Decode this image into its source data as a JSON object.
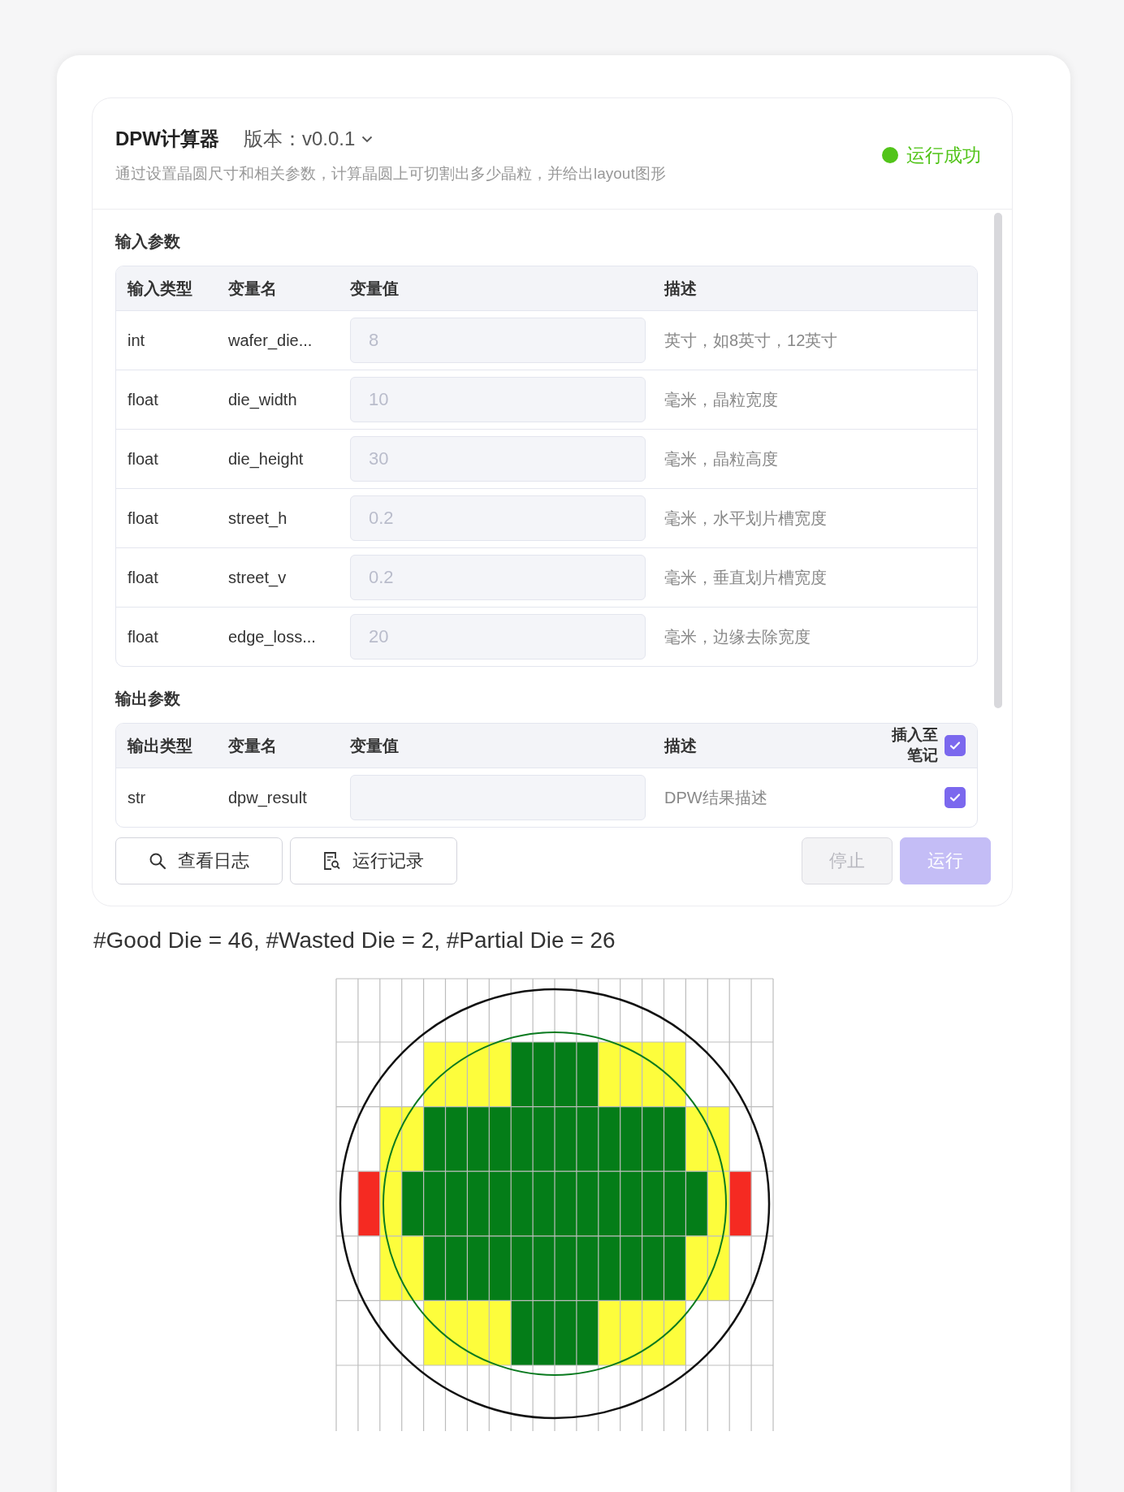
{
  "header": {
    "title": "DPW计算器",
    "version_label": "版本：v0.0.1",
    "description": "通过设置晶圆尺寸和相关参数，计算晶圆上可切割出多少晶粒，并给出layout图形",
    "status": {
      "kind": "success",
      "text": "运行成功"
    }
  },
  "input_section": {
    "title": "输入参数",
    "columns": [
      "输入类型",
      "变量名",
      "变量值",
      "描述"
    ],
    "rows": [
      {
        "type": "int",
        "name": "wafer_die...",
        "value": "8",
        "description": "英寸，如8英寸，12英寸"
      },
      {
        "type": "float",
        "name": "die_width",
        "value": "10",
        "description": "毫米，晶粒宽度"
      },
      {
        "type": "float",
        "name": "die_height",
        "value": "30",
        "description": "毫米，晶粒高度"
      },
      {
        "type": "float",
        "name": "street_h",
        "value": "0.2",
        "description": "毫米，水平划片槽宽度"
      },
      {
        "type": "float",
        "name": "street_v",
        "value": "0.2",
        "description": "毫米，垂直划片槽宽度"
      },
      {
        "type": "float",
        "name": "edge_loss...",
        "value": "20",
        "description": "毫米，边缘去除宽度"
      }
    ]
  },
  "output_section": {
    "title": "输出参数",
    "columns": [
      "输出类型",
      "变量名",
      "变量值",
      "描述"
    ],
    "insert_header": {
      "label": "插入至笔记",
      "checked": true
    },
    "rows": [
      {
        "type": "str",
        "name": "dpw_result",
        "description": "DPW结果描述",
        "checked": true
      }
    ]
  },
  "tools": [
    {
      "label": "查看日志"
    },
    {
      "label": "运行记录"
    }
  ],
  "actions": [
    {
      "label": "停止",
      "kind": "default",
      "disabled": true
    },
    {
      "label": "运行",
      "kind": "primary",
      "disabled": true
    }
  ],
  "result": {
    "text": "#Good Die = 46, #Wasted Die = 2, #Partial Die = 26"
  }
}
